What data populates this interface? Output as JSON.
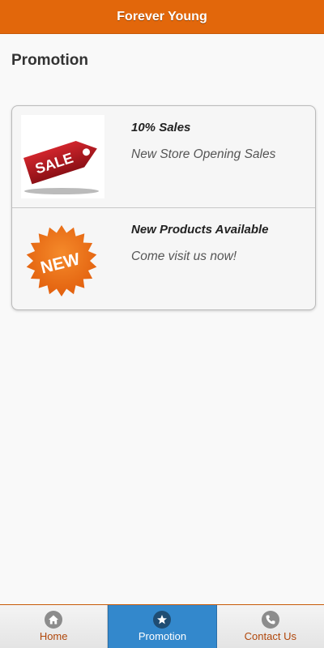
{
  "header": {
    "title": "Forever Young"
  },
  "page": {
    "title": "Promotion"
  },
  "promotions": [
    {
      "title": "10% Sales",
      "description": "New Store Opening Sales",
      "image": "sale-tag-icon",
      "image_text": "SALE",
      "color": "#b01c24"
    },
    {
      "title": "New Products Available",
      "description": "Come visit us now!",
      "image": "new-badge-icon",
      "image_text": "NEW",
      "color": "#e8721a"
    }
  ],
  "tabs": [
    {
      "label": "Home",
      "icon": "home-icon",
      "active": false
    },
    {
      "label": "Promotion",
      "icon": "star-icon",
      "active": true
    },
    {
      "label": "Contact Us",
      "icon": "phone-icon",
      "active": false
    }
  ],
  "colors": {
    "header": "#e2670b",
    "active_tab": "#3388cc",
    "tab_text": "#b0470b"
  }
}
